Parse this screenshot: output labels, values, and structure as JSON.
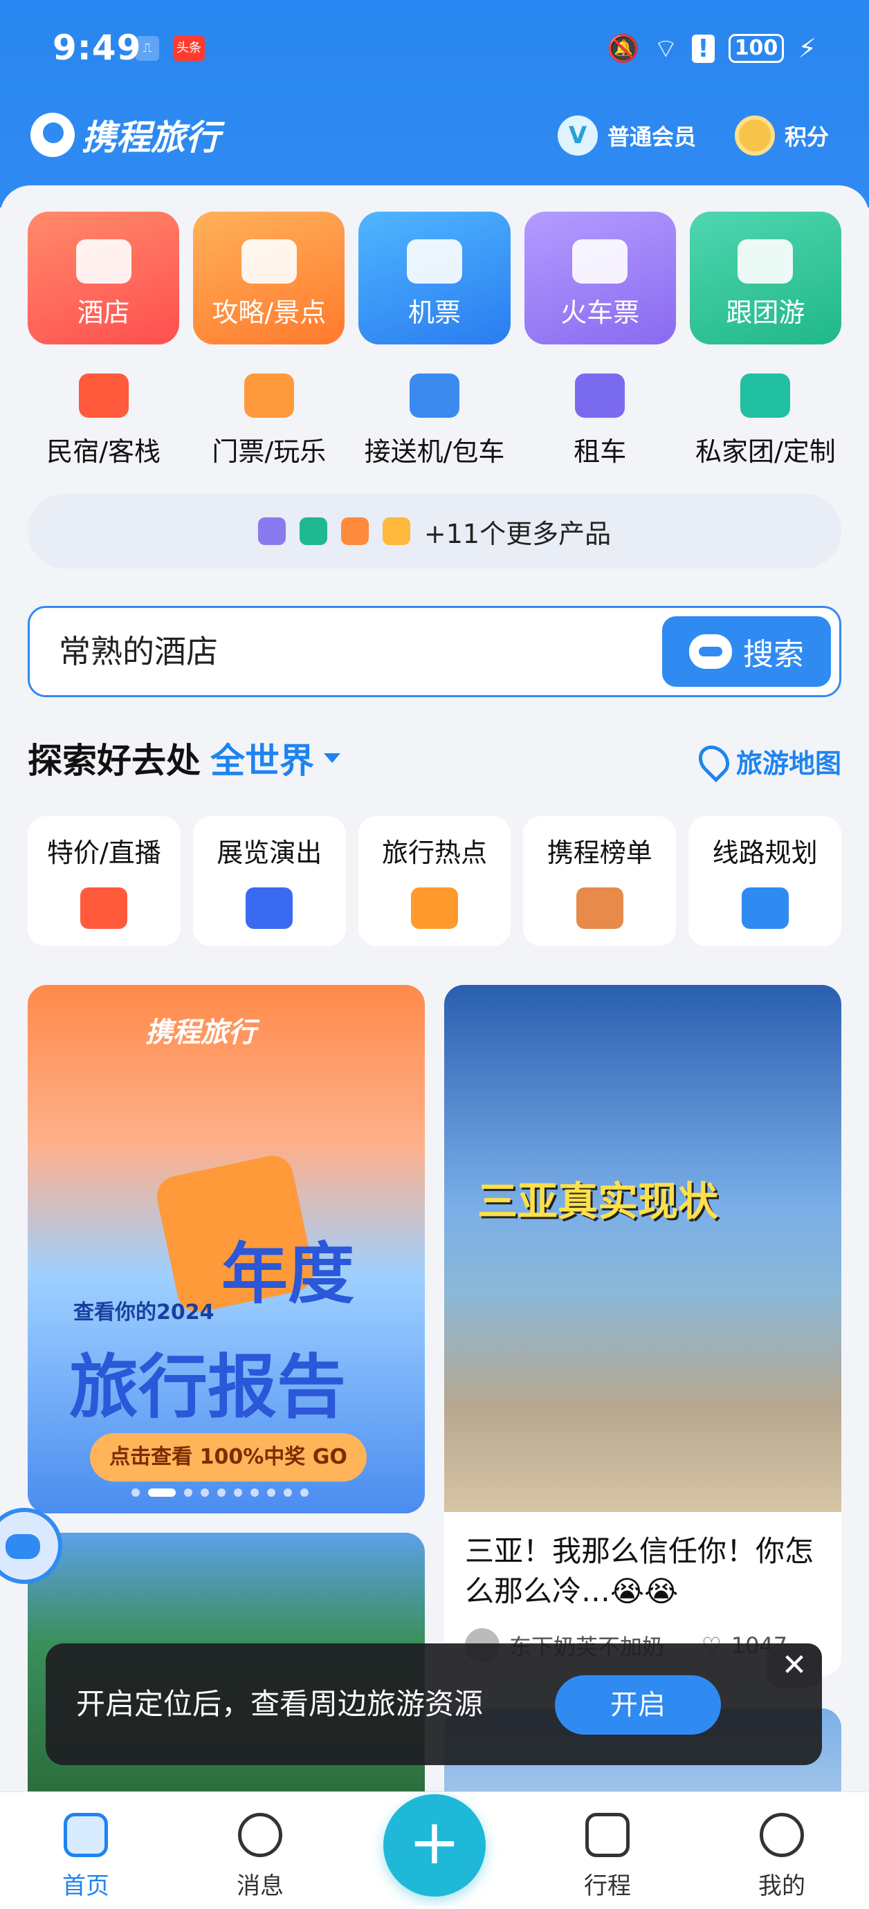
{
  "status_bar": {
    "time": "9:49",
    "notif_badge": "头条",
    "battery": "100"
  },
  "header": {
    "brand": "携程旅行",
    "member_label": "普通会员",
    "member_badge": "V",
    "points_label": "积分"
  },
  "main_tiles": [
    {
      "label": "酒店"
    },
    {
      "label": "攻略/景点"
    },
    {
      "label": "机票"
    },
    {
      "label": "火车票"
    },
    {
      "label": "跟团游"
    }
  ],
  "sub_services": [
    {
      "label": "民宿/客栈"
    },
    {
      "label": "门票/玩乐"
    },
    {
      "label": "接送机/包车"
    },
    {
      "label": "租车"
    },
    {
      "label": "私家团/定制"
    }
  ],
  "more_products": {
    "label": "+11个更多产品"
  },
  "search": {
    "query": "常熟的酒店",
    "button_label": "搜索"
  },
  "explore": {
    "title": "探索好去处",
    "region": "全世界",
    "map_label": "旅游地图"
  },
  "categories": [
    {
      "label": "特价/直播"
    },
    {
      "label": "展览演出"
    },
    {
      "label": "旅行热点"
    },
    {
      "label": "携程榜单"
    },
    {
      "label": "线路规划"
    }
  ],
  "feed": {
    "left_card": {
      "logo": "携程旅行",
      "subtitle": "查看你的2024",
      "title_line1": "年度",
      "title_line2": "旅行报告",
      "cta": "点击查看 100%中奖 GO"
    },
    "right_card": {
      "overlay_title": "三亚真实现状",
      "text": "三亚！我那么信任你！你怎么那么冷…😭😭",
      "author": "东下奶芙不加奶",
      "likes": "1047"
    }
  },
  "toast": {
    "message": "开启定位后，查看周边旅游资源",
    "button": "开启",
    "close": "✕"
  },
  "tabbar": {
    "items": [
      {
        "label": "首页"
      },
      {
        "label": "消息"
      },
      {
        "label": "行程"
      },
      {
        "label": "我的"
      }
    ],
    "fab": "+"
  },
  "colors": {
    "primary": "#2f8bf2",
    "accent": "#1fb8d8"
  }
}
